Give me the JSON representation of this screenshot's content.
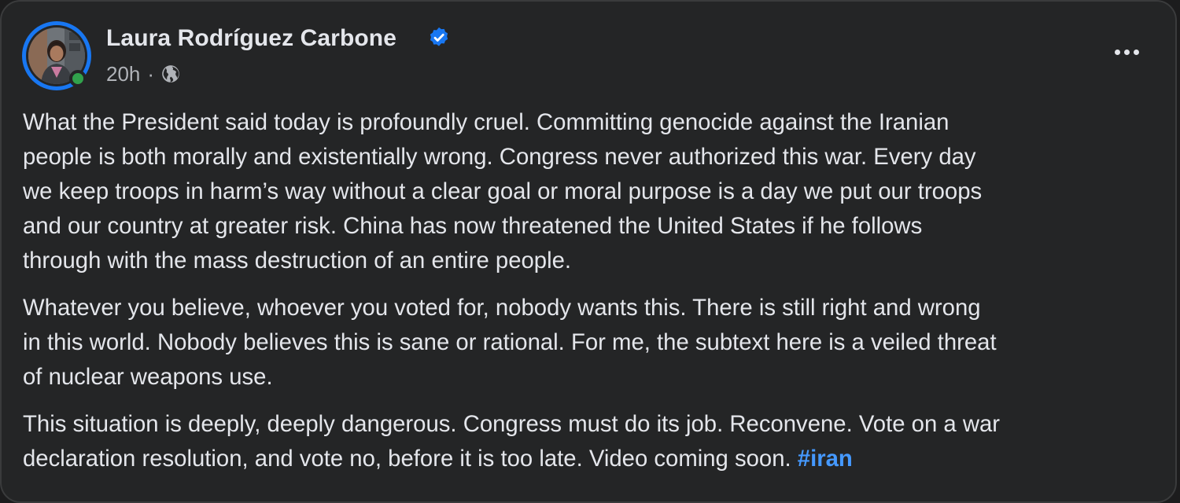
{
  "post": {
    "author": {
      "name": "Laura Rodríguez Carbone",
      "verified_icon": "verified-badge-icon",
      "avatar_icon": "profile-photo",
      "online_status_color": "#31a24c"
    },
    "meta": {
      "time": "20h",
      "separator": "·",
      "audience_icon": "globe-icon"
    },
    "more_icon": "more-options-icon",
    "paragraphs": [
      {
        "lines": [
          "What the President said today is profoundly cruel. Committing genocide against the Iranian",
          "people is both morally and existentially wrong. Congress never authorized this war. Every day",
          "we keep troops in harm’s way without a clear goal or moral purpose is a day we put our troops",
          "and our country at greater risk. China has now threatened the United States if he follows",
          "through with the mass destruction of an entire people."
        ]
      },
      {
        "lines": [
          "Whatever you believe, whoever you voted for, nobody wants this. There is still right and wrong",
          "in this world. Nobody believes this is sane or rational. For me, the subtext here is a veiled threat",
          "of nuclear weapons use."
        ]
      },
      {
        "lines": [
          "This situation is deeply, deeply dangerous. Congress must do its job. Reconvene. Vote on a war",
          "declaration resolution, and vote no, before it is too late. Video coming soon. "
        ],
        "hashtag": "#iran"
      }
    ],
    "colors": {
      "card_background": "#242526",
      "text_primary": "#e4e6eb",
      "text_secondary": "#b0b3b8",
      "verified_blue": "#1877f2",
      "hashtag_blue": "#4599ff"
    }
  }
}
